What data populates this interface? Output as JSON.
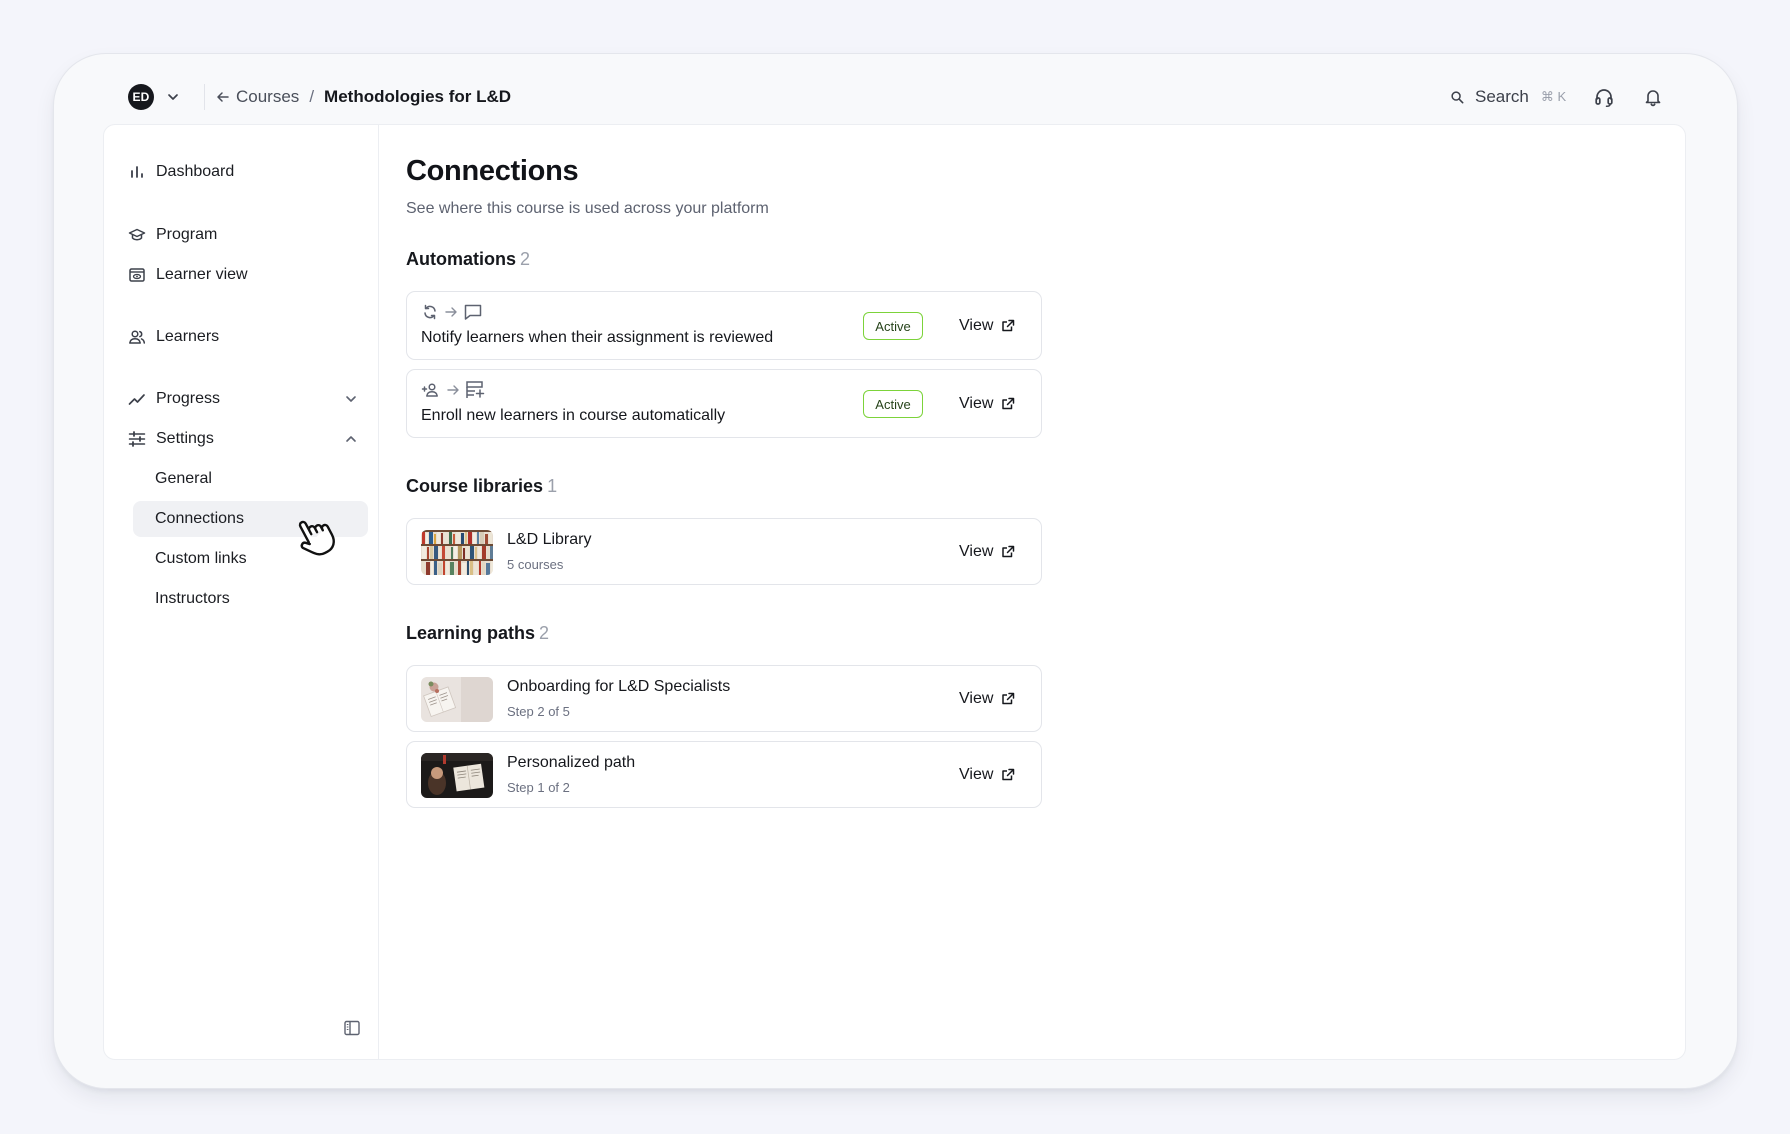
{
  "topbar": {
    "workspace_initials": "ED",
    "breadcrumb_parent": "Courses",
    "breadcrumb_separator": "/",
    "breadcrumb_current": "Methodologies for L&D",
    "search_label": "Search",
    "search_shortcut": "⌘ K"
  },
  "sidebar": {
    "items": [
      {
        "label": "Dashboard",
        "icon": "bar-chart-icon"
      },
      {
        "label": "Program",
        "icon": "graduation-cap-icon"
      },
      {
        "label": "Learner view",
        "icon": "eye-window-icon"
      },
      {
        "label": "Learners",
        "icon": "users-icon"
      },
      {
        "label": "Progress",
        "icon": "trend-line-icon"
      },
      {
        "label": "Settings",
        "icon": "sliders-icon"
      }
    ],
    "settings_sub": [
      "General",
      "Connections",
      "Custom links",
      "Instructors"
    ],
    "active_item": "Connections"
  },
  "main": {
    "title": "Connections",
    "subtitle": "See where this course is used across your platform",
    "automations": {
      "heading": "Automations",
      "count": "2",
      "items": [
        {
          "title": "Notify learners when their assignment is reviewed",
          "status": "Active",
          "action": "View",
          "trigger_icon": "refresh-icon",
          "action_icon": "message-icon"
        },
        {
          "title": "Enroll new learners in course automatically",
          "status": "Active",
          "action": "View",
          "trigger_icon": "user-plus-icon",
          "action_icon": "list-add-icon"
        }
      ]
    },
    "libraries": {
      "heading": "Course libraries",
      "count": "1",
      "items": [
        {
          "title": "L&D Library",
          "meta": "5 courses",
          "action": "View"
        }
      ]
    },
    "paths": {
      "heading": "Learning paths",
      "count": "2",
      "items": [
        {
          "title": "Onboarding for L&D Specialists",
          "meta": "Step 2 of 5",
          "action": "View"
        },
        {
          "title": "Personalized path",
          "meta": "Step 1 of 2",
          "action": "View"
        }
      ]
    }
  },
  "colors": {
    "accent_active_border": "#7cd33a",
    "text_primary": "#16181d",
    "text_muted": "#6b7080"
  }
}
